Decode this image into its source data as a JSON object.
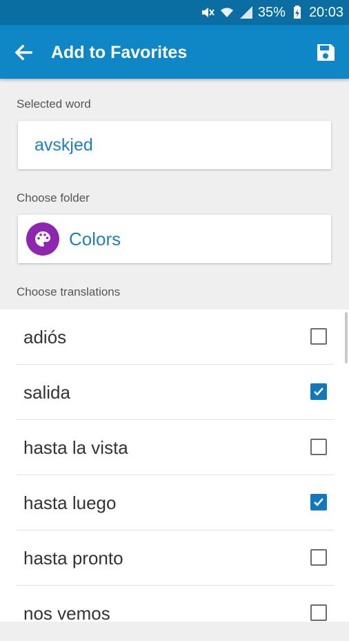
{
  "status_bar": {
    "battery_percent": "35%",
    "time": "20:03",
    "icons": [
      "mute-icon",
      "wifi-icon",
      "signal-icon",
      "battery-charging-icon"
    ]
  },
  "app_bar": {
    "title": "Add to Favorites",
    "back_icon": "arrow-left-icon",
    "save_icon": "floppy-disk-icon",
    "color": "#0f87c6"
  },
  "selected_word": {
    "label": "Selected word",
    "value": "avskjed"
  },
  "folder": {
    "label": "Choose folder",
    "name": "Colors",
    "icon": "palette-icon",
    "icon_color": "#8d27b0"
  },
  "translations": {
    "label": "Choose translations",
    "items": [
      {
        "text": "adiós",
        "checked": false
      },
      {
        "text": "salida",
        "checked": true
      },
      {
        "text": "hasta la vista",
        "checked": false
      },
      {
        "text": "hasta luego",
        "checked": true
      },
      {
        "text": "hasta pronto",
        "checked": false
      },
      {
        "text": "nos vemos",
        "checked": false
      }
    ]
  }
}
